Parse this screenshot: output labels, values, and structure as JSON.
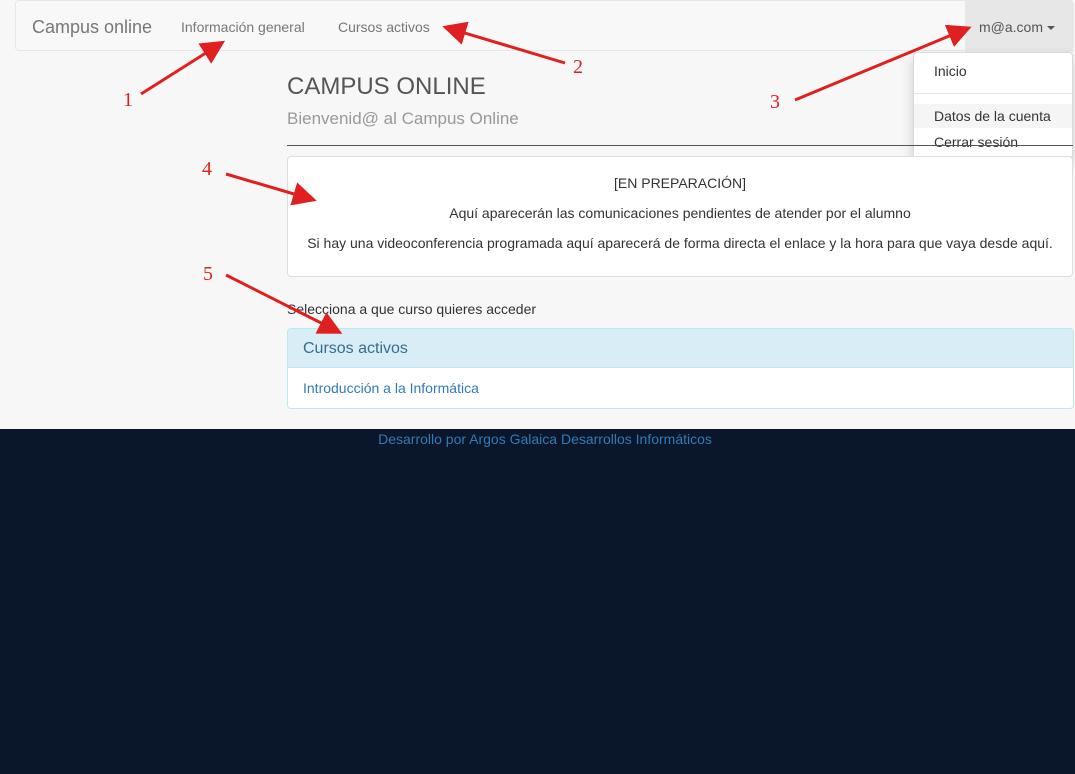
{
  "navbar": {
    "brand": "Campus online",
    "links": [
      "Información general",
      "Cursos activos"
    ],
    "user": "m@a.com"
  },
  "dropdown": {
    "items": [
      "Inicio",
      "Datos de la cuenta",
      "Cerrar sesión"
    ],
    "active": "Datos de la cuenta"
  },
  "main": {
    "title": "CAMPUS ONLINE",
    "subtitle": "Bienvenid@ al Campus Online",
    "notice": [
      "[EN PREPARACIÓN]",
      "Aquí aparecerán las comunicaciones pendientes de atender por el alumno",
      "Si hay una videoconferencia programada aquí aparecerá de forma directa el enlace y la hora para que vaya desde aquí."
    ],
    "select_label": "Selecciona a que curso quieres acceder",
    "panel_title": "Cursos activos",
    "courses": [
      "Introducción a la Informática"
    ]
  },
  "footer": "Desarrollo por Argos Galaica Desarrollos Informáticos",
  "annotations": [
    "1",
    "2",
    "3",
    "4",
    "5"
  ],
  "colors": {
    "annotation": "#e02020",
    "link": "#337ab7",
    "panel_header": "#d9edf7",
    "footer_bg": "#0a172a"
  }
}
